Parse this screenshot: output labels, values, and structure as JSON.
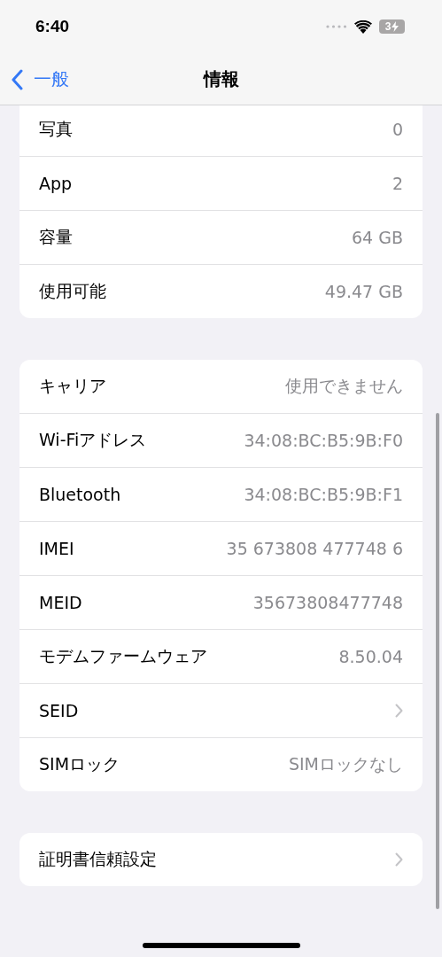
{
  "status_bar": {
    "time": "6:40",
    "battery": "3"
  },
  "nav": {
    "back": "一般",
    "title": "情報"
  },
  "groups": [
    {
      "cut_top": true,
      "rows": [
        {
          "kind": "value",
          "label": "写真",
          "value": "0"
        },
        {
          "kind": "value",
          "label": "App",
          "value": "2"
        },
        {
          "kind": "value",
          "label": "容量",
          "value": "64 GB"
        },
        {
          "kind": "value",
          "label": "使用可能",
          "value": "49.47 GB"
        }
      ]
    },
    {
      "cut_top": false,
      "rows": [
        {
          "kind": "value",
          "label": "キャリア",
          "value": "使用できません"
        },
        {
          "kind": "value",
          "label": "Wi-Fiアドレス",
          "value": "34:08:BC:B5:9B:F0"
        },
        {
          "kind": "value",
          "label": "Bluetooth",
          "value": "34:08:BC:B5:9B:F1"
        },
        {
          "kind": "value",
          "label": "IMEI",
          "value": "35 673808 477748 6"
        },
        {
          "kind": "value",
          "label": "MEID",
          "value": "35673808477748"
        },
        {
          "kind": "value",
          "label": "モデムファームウェア",
          "value": "8.50.04"
        },
        {
          "kind": "link",
          "label": "SEID"
        },
        {
          "kind": "value",
          "label": "SIMロック",
          "value": "SIMロックなし"
        }
      ]
    },
    {
      "cut_top": false,
      "rows": [
        {
          "kind": "link",
          "label": "証明書信頼設定"
        }
      ]
    }
  ]
}
